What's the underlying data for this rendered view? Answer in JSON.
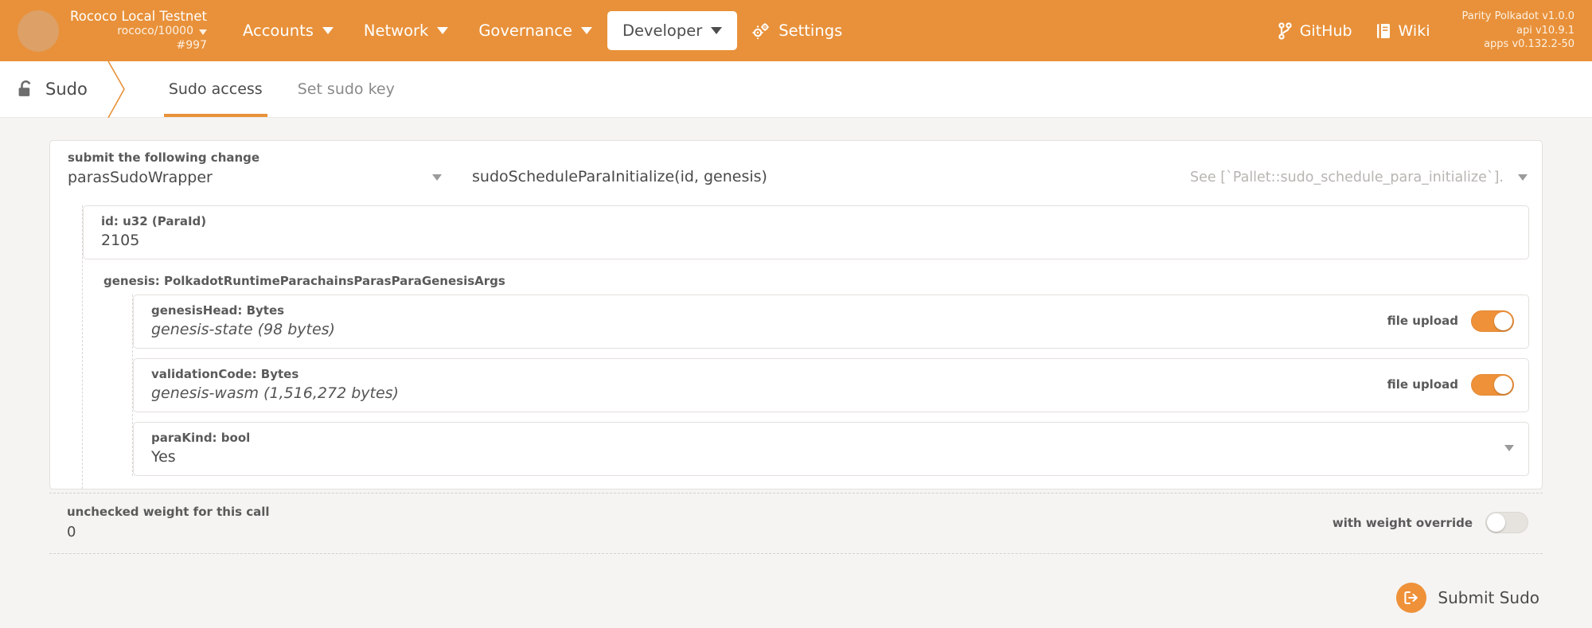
{
  "topbar": {
    "chain_name": "Rococo Local Testnet",
    "chain_spec": "rococo/10000",
    "block": "#997",
    "nav": [
      {
        "label": "Accounts",
        "icon": "chevron-down-icon",
        "active": false
      },
      {
        "label": "Network",
        "icon": "chevron-down-icon",
        "active": false
      },
      {
        "label": "Governance",
        "icon": "chevron-down-icon",
        "active": false
      },
      {
        "label": "Developer",
        "icon": "chevron-down-icon",
        "active": true
      },
      {
        "label": "Settings",
        "icon": "gears-icon",
        "active": false
      }
    ],
    "links": [
      {
        "label": "GitHub",
        "icon": "git-branch-icon"
      },
      {
        "label": "Wiki",
        "icon": "book-icon"
      }
    ],
    "versions": {
      "line1": "Parity Polkadot v1.0.0",
      "line2": "api v10.9.1",
      "line3": "apps v0.132.2-50"
    },
    "colors": {
      "bar_bg": "#e8913a",
      "avatar": "#dda066",
      "text": "#ffffff"
    }
  },
  "breadcrumb": {
    "label": "Sudo",
    "icon": "lock-open-icon"
  },
  "tabs": [
    {
      "label": "Sudo access",
      "active": true
    },
    {
      "label": "Set sudo key",
      "active": false
    }
  ],
  "extrinsic": {
    "section_label": "submit the following change",
    "module": "parasSudoWrapper",
    "method": "sudoScheduleParaInitialize(id, genesis)",
    "doc": "See [`Pallet::sudo_schedule_para_initialize`]."
  },
  "params": {
    "id": {
      "label": "id: u32 (ParaId)",
      "value": "2105"
    },
    "genesis_header": "genesis: PolkadotRuntimeParachainsParasParaGenesisArgs",
    "genesisHead": {
      "label": "genesisHead: Bytes",
      "value": "genesis-state (98 bytes)",
      "toggle_label": "file upload",
      "toggle_on": true
    },
    "validationCode": {
      "label": "validationCode: Bytes",
      "value": "genesis-wasm (1,516,272 bytes)",
      "toggle_label": "file upload",
      "toggle_on": true
    },
    "paraKind": {
      "label": "paraKind: bool",
      "value": "Yes"
    }
  },
  "weight": {
    "label": "unchecked weight for this call",
    "value": "0",
    "override_label": "with weight override",
    "override_on": false
  },
  "submit": {
    "label": "Submit Sudo",
    "icon": "sign-in-icon",
    "accent": "#ef9139"
  }
}
